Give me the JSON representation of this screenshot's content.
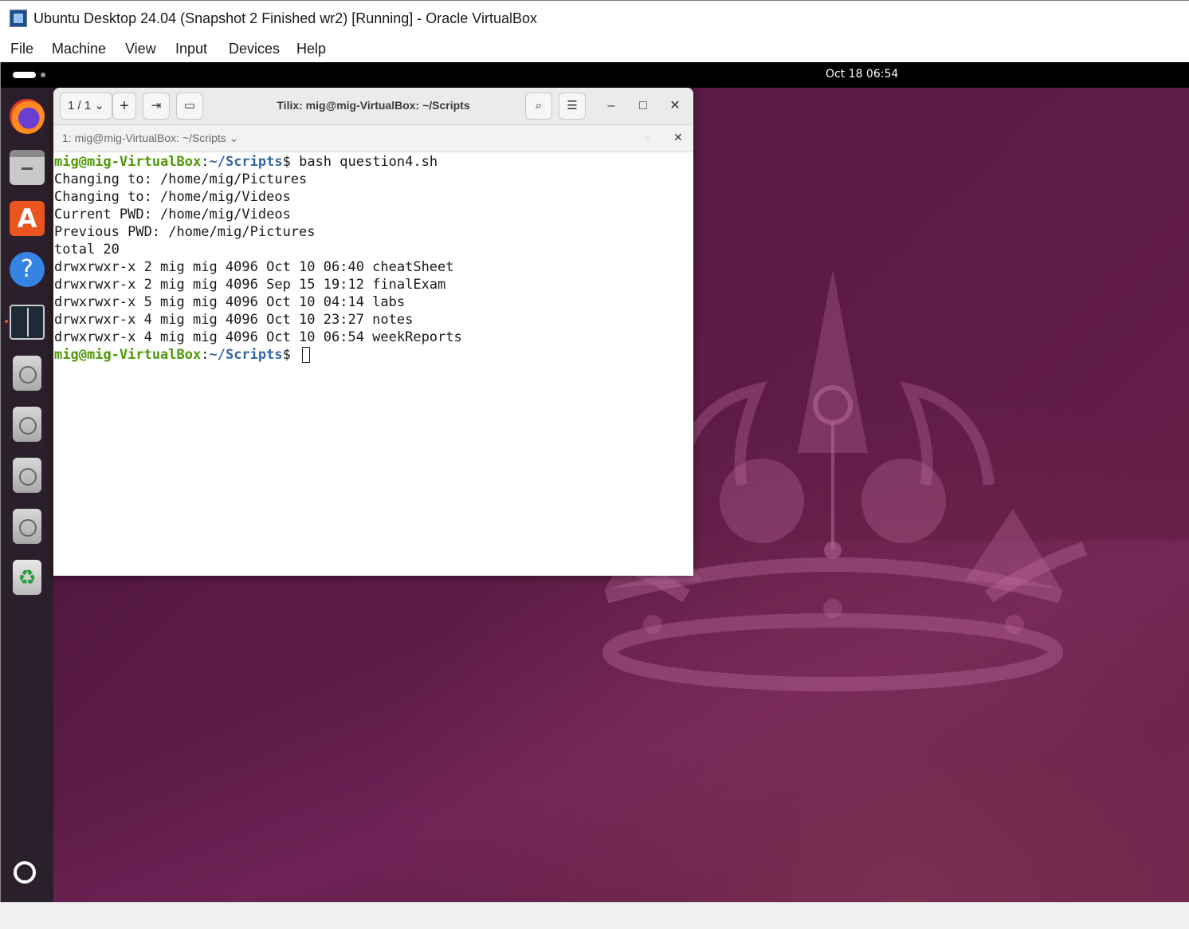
{
  "host": {
    "title": "Ubuntu Desktop 24.04 (Snapshot 2 Finished wr2) [Running] - Oracle VirtualBox",
    "menu": [
      "File",
      "Machine",
      "View",
      "Input",
      "Devices",
      "Help"
    ]
  },
  "guest": {
    "clock": "Oct 18  06:54",
    "dock": [
      "firefox-icon",
      "files-icon",
      "app-center-icon",
      "help-icon",
      "terminal-icon",
      "disc-icon",
      "disc-icon",
      "disc-icon",
      "disc-icon",
      "trash-icon",
      "show-apps-icon"
    ]
  },
  "tilix": {
    "session_counter": "1 / 1",
    "add_label": "+",
    "title": "Tilix: mig@mig-VirtualBox: ~/Scripts",
    "minimize": "–",
    "maximize": "□",
    "close": "✕",
    "session_label": "1: mig@mig-VirtualBox: ~/Scripts",
    "terminal_close": "✕"
  },
  "terminal": {
    "prompt_user": "mig@mig-VirtualBox",
    "prompt_path": "~/Scripts",
    "prompt_suffix": "$ ",
    "command": "bash question4.sh",
    "output": [
      "Changing to: /home/mig/Pictures",
      "Changing to: /home/mig/Videos",
      "Current PWD: /home/mig/Videos",
      "Previous PWD: /home/mig/Pictures",
      "total 20",
      "drwxrwxr-x 2 mig mig 4096 Oct 10 06:40 cheatSheet",
      "drwxrwxr-x 2 mig mig 4096 Sep 15 19:12 finalExam",
      "drwxrwxr-x 5 mig mig 4096 Oct 10 04:14 labs",
      "drwxrwxr-x 4 mig mig 4096 Oct 10 23:27 notes",
      "drwxrwxr-x 4 mig mig 4096 Oct 10 06:54 weekReports"
    ]
  },
  "colors": {
    "prompt_user": "#4e9a06",
    "prompt_path": "#3465a4",
    "wallpaper": "#5a1a45",
    "accent": "#e95420"
  }
}
